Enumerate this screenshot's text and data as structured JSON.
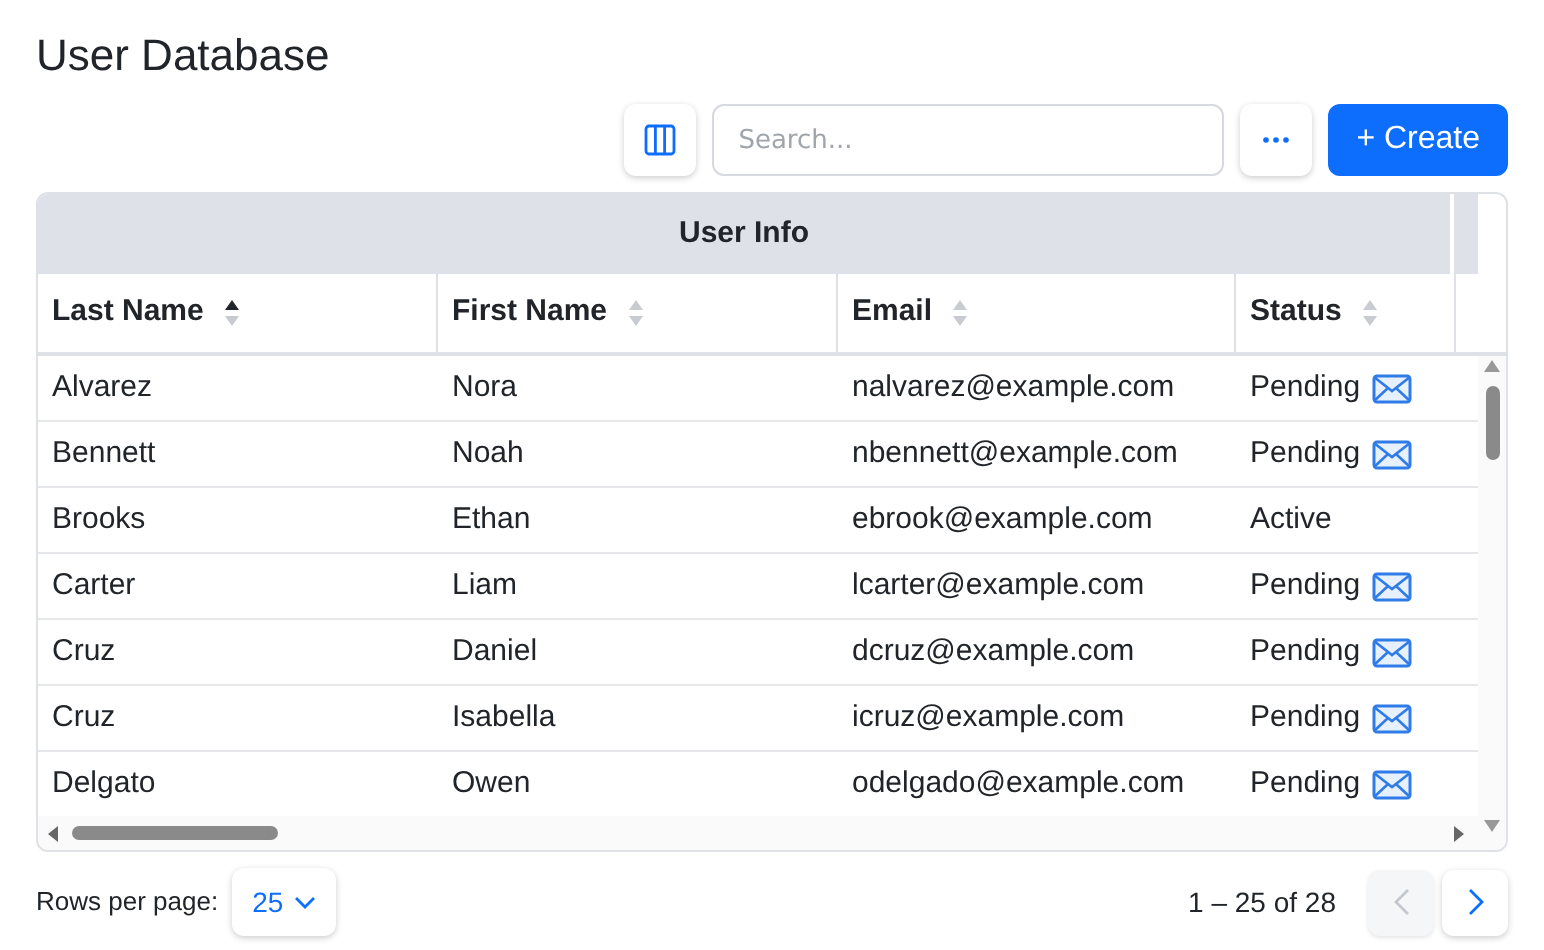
{
  "title": "User Database",
  "toolbar": {
    "search_placeholder": "Search...",
    "create_label": "+ Create"
  },
  "table": {
    "group_header": "User Info",
    "columns": [
      {
        "label": "Last Name",
        "sorted_ascending": true
      },
      {
        "label": "First Name",
        "sorted_ascending": false
      },
      {
        "label": "Email",
        "sorted_ascending": false
      },
      {
        "label": "Status",
        "sorted_ascending": false
      }
    ],
    "rows": [
      {
        "last": "Alvarez",
        "first": "Nora",
        "email": "nalvarez@example.com",
        "status": "Pending",
        "mail": true
      },
      {
        "last": "Bennett",
        "first": "Noah",
        "email": "nbennett@example.com",
        "status": "Pending",
        "mail": true
      },
      {
        "last": "Brooks",
        "first": "Ethan",
        "email": "ebrook@example.com",
        "status": "Active",
        "mail": false
      },
      {
        "last": "Carter",
        "first": "Liam",
        "email": "lcarter@example.com",
        "status": "Pending",
        "mail": true
      },
      {
        "last": "Cruz",
        "first": "Daniel",
        "email": "dcruz@example.com",
        "status": "Pending",
        "mail": true
      },
      {
        "last": "Cruz",
        "first": "Isabella",
        "email": "icruz@example.com",
        "status": "Pending",
        "mail": true
      },
      {
        "last": "Delgato",
        "first": "Owen",
        "email": "odelgado@example.com",
        "status": "Pending",
        "mail": true
      }
    ]
  },
  "pagination": {
    "rows_per_page_label": "Rows per page:",
    "rows_per_page": "25",
    "range": "1 – 25 of 28",
    "prev_disabled": true,
    "next_disabled": false
  }
}
